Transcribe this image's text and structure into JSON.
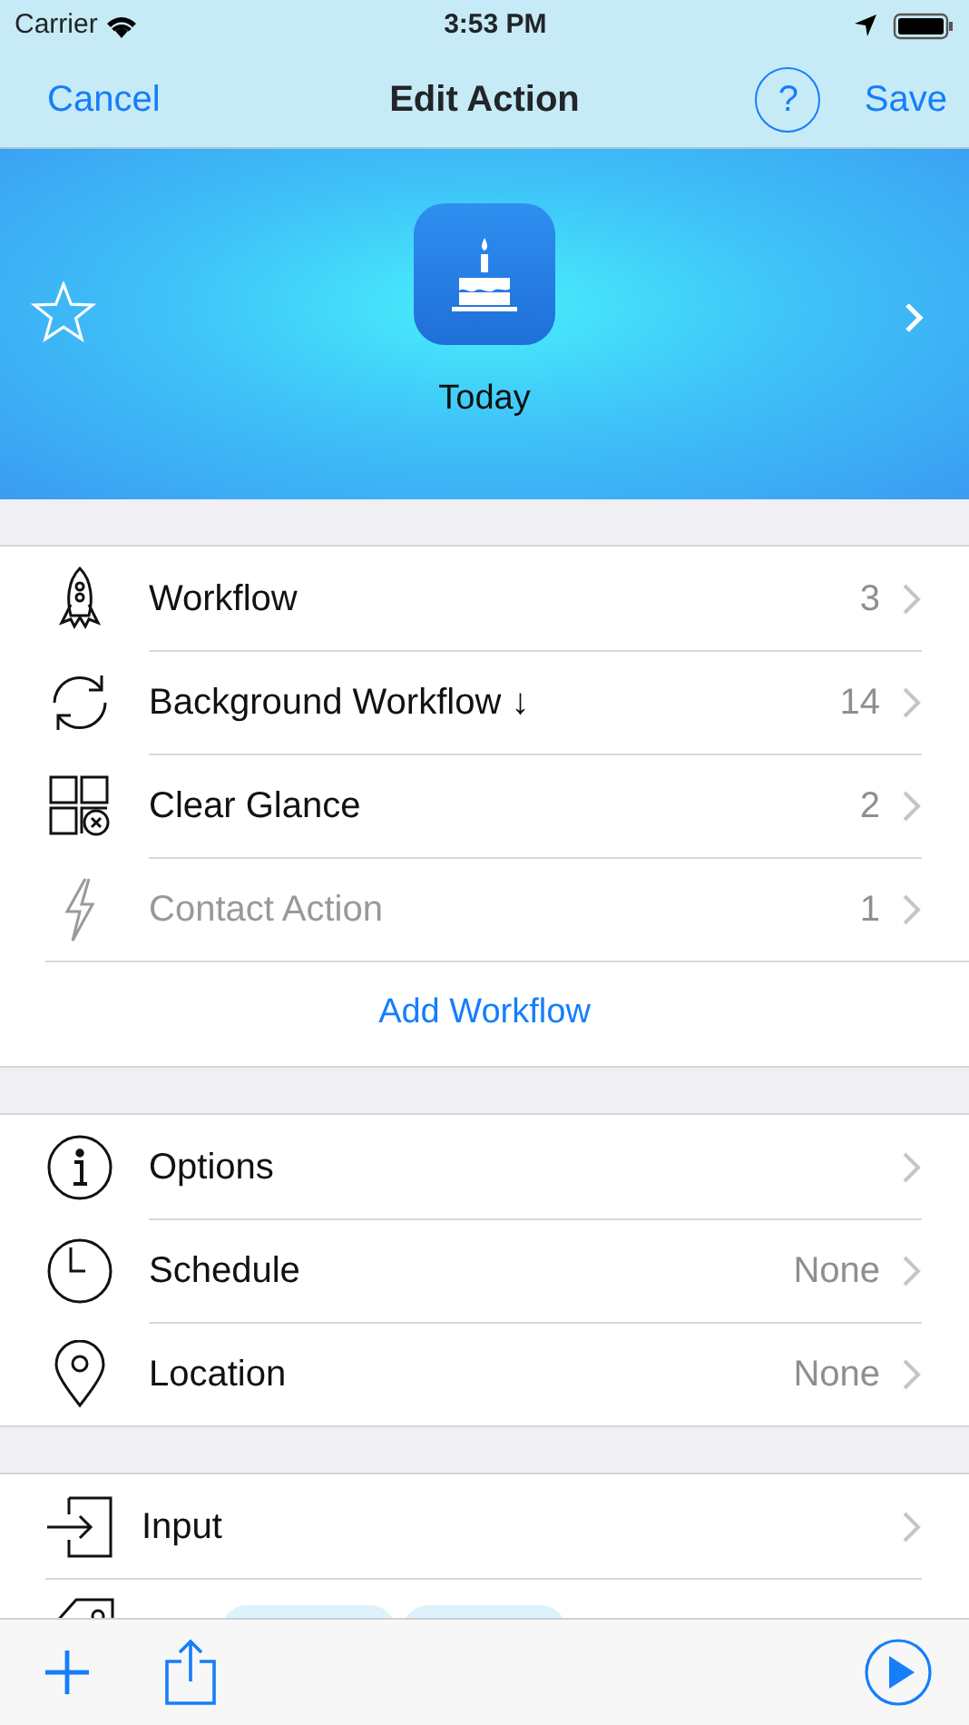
{
  "status_bar": {
    "carrier": "Carrier",
    "time": "3:53 PM"
  },
  "nav": {
    "cancel": "Cancel",
    "title": "Edit Action",
    "help": "?",
    "save": "Save"
  },
  "header": {
    "favorite": false,
    "name": "Today"
  },
  "workflows": [
    {
      "label": "Workflow",
      "count": "3",
      "disabled": false
    },
    {
      "label": "Background Workflow ↓",
      "count": "14",
      "disabled": false
    },
    {
      "label": "Clear Glance",
      "count": "2",
      "disabled": false
    },
    {
      "label": "Contact Action",
      "count": "1",
      "disabled": true
    }
  ],
  "add_workflow": "Add Workflow",
  "settings": [
    {
      "label": "Options"
    },
    {
      "label": "Schedule",
      "value": "None"
    },
    {
      "label": "Location",
      "value": "None"
    }
  ],
  "more": [
    {
      "label": "Input",
      "kind": "row"
    },
    {
      "kind": "tags"
    }
  ]
}
